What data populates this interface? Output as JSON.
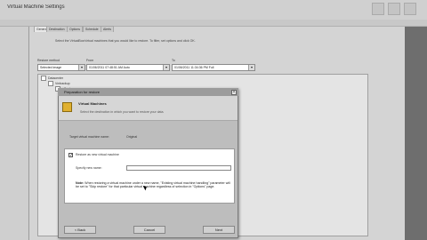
{
  "window": {
    "title": "Virtual Machine Settings",
    "controls": [
      "minimize-icon",
      "maximize-icon",
      "close-icon"
    ]
  },
  "tabs": [
    {
      "label": "General",
      "active": true
    },
    {
      "label": "Destination",
      "active": false
    },
    {
      "label": "Options",
      "active": false
    },
    {
      "label": "Schedule",
      "active": false
    },
    {
      "label": "Alerts",
      "active": false
    }
  ],
  "description": "Select the VirtualBox/virtual machines that you would like to restore. To filter, set options and click OK.",
  "filters": {
    "restore_method_label": "Restore method",
    "restore_method_value": "Selected image",
    "from_label": "From",
    "from_value": "01/06/2011 07:48:51 AM Auto",
    "to_label": "To",
    "to_value": "01/06/2011 11:34:36 PM Full"
  },
  "tree": {
    "items": [
      "Datacenter",
      "Vmbackup",
      "vCenter"
    ]
  },
  "dialog": {
    "title": "Preparation for restore",
    "header_title": "Virtual Machines",
    "header_subtitle": "Select the destination in which you want to restore your data.",
    "target_label": "Target virtual machine name:",
    "target_value": "Original",
    "restore_new_label": "Restore as new virtual machine",
    "restore_new_checked": true,
    "vm_name_label": "Specify new name:",
    "vm_name_value": "",
    "note_bold": "Note:",
    "note_text": " When restoring a virtual machine under a new name, \"Existing virtual machine handling\" parameter will be set to \"Skip restore\" for that particular virtual machine regardless of selection in \"Options\" page.",
    "buttons": {
      "back": "< Back",
      "cancel": "Cancel",
      "next": "Next"
    }
  }
}
